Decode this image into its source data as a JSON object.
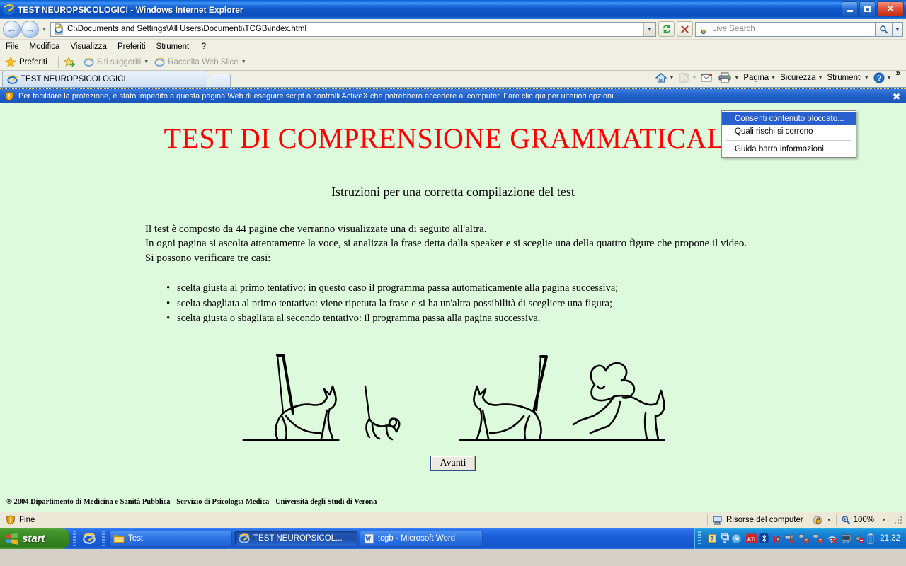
{
  "window": {
    "title": "TEST NEUROPSICOLOGICI - Windows Internet Explorer",
    "minimize_label": "Riduci a icona",
    "maximize_label": "Ingrandisci",
    "close_label": "Chiudi"
  },
  "nav": {
    "back_label": "Indietro",
    "forward_label": "Avanti",
    "recent_label": "Pagine recenti",
    "address": "C:\\Documents and Settings\\All Users\\Documenti\\TCGB\\index.html",
    "refresh_label": "Aggiorna",
    "stop_label": "Interrompi",
    "search_placeholder": "Live Search",
    "search_value": "",
    "search_button_label": "Cerca"
  },
  "menubar": {
    "items": [
      "File",
      "Modifica",
      "Visualizza",
      "Preferiti",
      "Strumenti",
      "?"
    ]
  },
  "favbar": {
    "favorites_label": "Preferiti",
    "suggested_sites": "Siti suggeriti",
    "web_slice": "Raccolta Web Slice"
  },
  "tabs": [
    {
      "label": "TEST NEUROPSICOLOGICI",
      "active": true
    }
  ],
  "newtab_label": "Nuova scheda",
  "commandbar": {
    "home": "Pagina iniziale",
    "feeds": "Feed",
    "mail": "Posta",
    "print": "Stampa",
    "page": "Pagina",
    "security": "Sicurezza",
    "tools": "Strumenti",
    "help": "?",
    "overflow": "»"
  },
  "infobar": {
    "message": "Per facilitare la protezione, è stato impedito a questa pagina Web di eseguire script o controlli ActiveX che potrebbero accedere al computer. Fare clic qui per ulteriori opzioni...",
    "close_label": "✖"
  },
  "dropdown": {
    "items": [
      {
        "label": "Consenti contenuto bloccato...",
        "selected": true
      },
      {
        "label": "Quali rischi si corrono",
        "selected": false
      },
      {
        "label": "Guida barra informazioni",
        "selected": false
      }
    ]
  },
  "content": {
    "title": "TEST DI COMPRENSIONE GRAMMATICALE",
    "subtitle": "Istruzioni per una corretta compilazione del test",
    "paragraph_lines": [
      "Il test è composto da 44 pagine che verranno visualizzate una di seguito all'altra.",
      "In ogni pagina si ascolta attentamente la voce, si analizza la frase detta dalla speaker e si sceglie una della quattro figure che propone il video.",
      "Si possono verificare tre casi:"
    ],
    "bullets": [
      "scelta giusta al primo tentativo: in questo caso il programma passa automaticamente alla pagina successiva;",
      "scelta sbagliata al primo tentativo: viene ripetuta la frase e si ha un'altra possibilità di scegliere una figura;",
      "scelta giusta o sbagliata al secondo tentativo: il programma passa alla pagina successiva."
    ],
    "figure_alt": "Quattro figure in bianco e nero: un gatto che salta, un topo, un gatto e un cane",
    "next_button": "Avanti",
    "copyright": "® 2004 Dipartimento di Medicina e Sanità Pubblica - Servizio di Psicologia Medica - Università degli Studi di Verona",
    "background_color": "#ddfadd",
    "title_color": "#ff0000"
  },
  "statusbar": {
    "status": "Fine",
    "zone": "Risorse del computer",
    "zoom": "100%"
  },
  "taskbar": {
    "start_label": "start",
    "quicklaunch": [
      "Internet Explorer"
    ],
    "buttons": [
      {
        "label": "Test",
        "icon": "folder-icon",
        "active": false
      },
      {
        "label": "TEST NEUROPSICOL...",
        "icon": "ie-icon",
        "active": true
      },
      {
        "label": "tcgb - Microsoft Word",
        "icon": "word-icon",
        "active": false
      }
    ],
    "tray_icons": [
      "help-icon",
      "display-icon",
      "show-hidden-icon",
      "ati-icon",
      "bluetooth-icon",
      "kaspersky-icon",
      "network-disconnected-icon",
      "network-disconnected-icon-2",
      "network-disconnected-icon-3",
      "wireless-off-icon",
      "monitor-icon",
      "volume-muted-icon",
      "battery-icon"
    ],
    "clock": "21.32"
  }
}
